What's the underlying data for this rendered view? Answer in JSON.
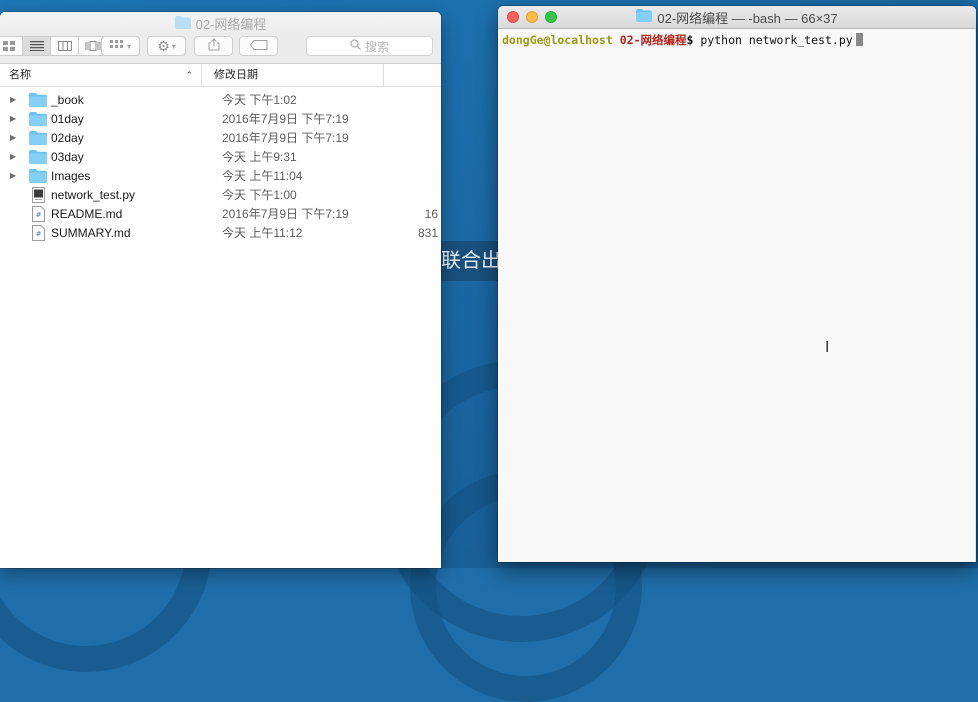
{
  "desktop": {
    "banner_text": "联合出"
  },
  "finder": {
    "title": "02-网络编程",
    "toolbar": {
      "search_placeholder": "搜索"
    },
    "columns": {
      "name": "名称",
      "date_modified": "修改日期",
      "size": ""
    },
    "files": [
      {
        "name": "_book",
        "date": "今天 下午1:02",
        "size": "",
        "type": "folder"
      },
      {
        "name": "01day",
        "date": "2016年7月9日 下午7:19",
        "size": "",
        "type": "folder"
      },
      {
        "name": "02day",
        "date": "2016年7月9日 下午7:19",
        "size": "",
        "type": "folder"
      },
      {
        "name": "03day",
        "date": "今天 上午9:31",
        "size": "",
        "type": "folder"
      },
      {
        "name": "Images",
        "date": "今天 上午11:04",
        "size": "",
        "type": "folder"
      },
      {
        "name": "network_test.py",
        "date": "今天 下午1:00",
        "size": "",
        "type": "script"
      },
      {
        "name": "README.md",
        "date": "2016年7月9日 下午7:19",
        "size": "16",
        "type": "markdown"
      },
      {
        "name": "SUMMARY.md",
        "date": "今天 上午11:12",
        "size": "831",
        "type": "markdown"
      }
    ]
  },
  "terminal": {
    "title": "02-网络编程 — -bash — 66×37",
    "prompt_user": "dongGe@localhost",
    "prompt_dir": "02-网络编程",
    "prompt_symbol": "$",
    "command": "python network_test.py"
  },
  "colors": {
    "desktop": "#1f6ea9",
    "folder": "#6cc3f4",
    "prompt_user": "#9a9a16",
    "prompt_dir": "#b3241d",
    "close": "#fc605b",
    "minimize": "#fdbc40",
    "maximize": "#34c84a"
  }
}
